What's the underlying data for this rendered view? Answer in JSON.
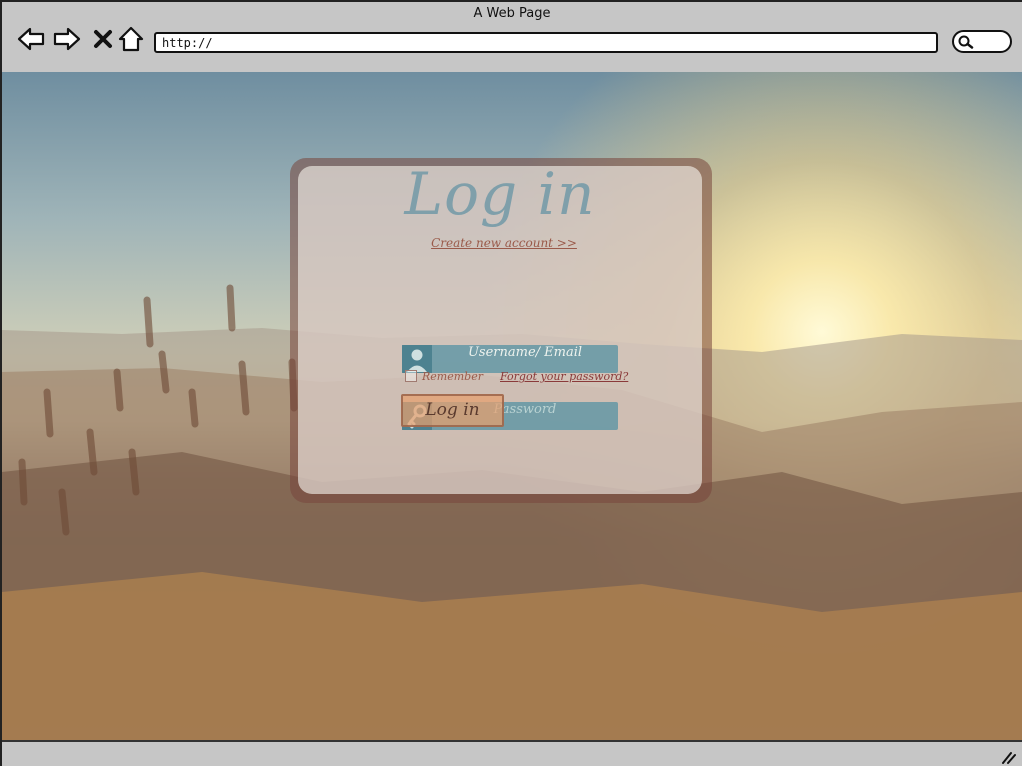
{
  "window": {
    "title": "A Web Page"
  },
  "browser": {
    "url": "http://",
    "icons": [
      "back-arrow-icon",
      "forward-arrow-icon",
      "stop-icon",
      "home-icon",
      "search-icon",
      "resize-grip-icon"
    ]
  },
  "login": {
    "title": "Log in",
    "create_account_link": "Create new account >>",
    "username_placeholder": "Username/ Email",
    "password_placeholder": "Password",
    "remember_label": "Remember",
    "forgot_link": "Forgot your password?",
    "submit_label": "Log in"
  },
  "colors": {
    "field_bg": "#5f96a5",
    "title_color": "#7f9faa",
    "button_bg": "#e8a06e",
    "link_color": "#9a5a4a"
  }
}
